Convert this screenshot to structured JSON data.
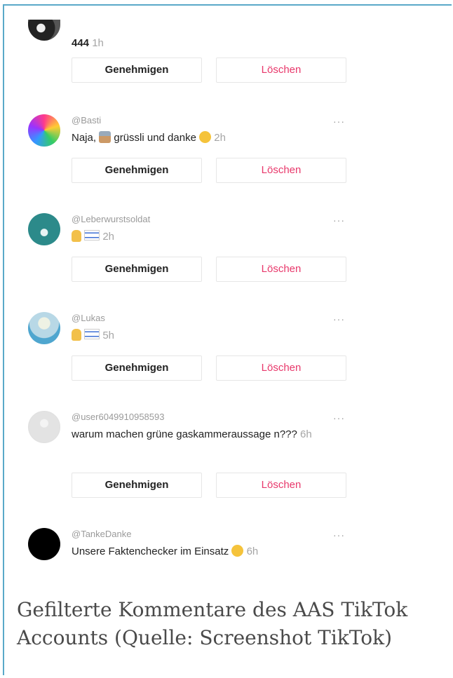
{
  "buttons": {
    "approve": "Genehmigen",
    "delete": "Löschen"
  },
  "more_icon": "more-horizontal-icon",
  "comments": [
    {
      "user": "",
      "text": "444",
      "time": "1h"
    },
    {
      "user": "@Basti",
      "text": "Naja, ",
      "text_after": " grüssli und danke ",
      "time": "2h"
    },
    {
      "user": "@Leberwurstsoldat",
      "text": "",
      "time": "2h"
    },
    {
      "user": "@Lukas",
      "text": "",
      "time": "5h"
    },
    {
      "user": "@user6049910958593",
      "text": "warum machen grüne gaskammeraussage n???",
      "time": "6h"
    },
    {
      "user": "@TankeDanke",
      "text": "Unsere Faktenchecker im Einsatz ",
      "time": "6h"
    }
  ],
  "caption": "Gefilterte Kommentare des AAS TikTok Accounts (Quelle: Screenshot TikTok)",
  "colors": {
    "delete_text": "#e8386b",
    "frame_border": "#5aa9c9"
  }
}
